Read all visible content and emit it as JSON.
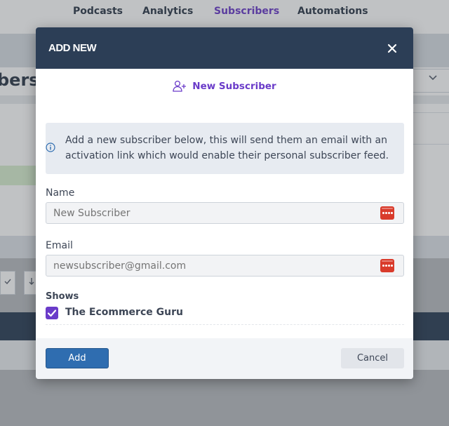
{
  "background": {
    "nav": {
      "items": [
        {
          "label": "Podcasts",
          "active": false
        },
        {
          "label": "Analytics",
          "active": false
        },
        {
          "label": "Subscribers",
          "active": true
        },
        {
          "label": "Automations",
          "active": false
        }
      ]
    },
    "page_title_fragment": "bers"
  },
  "modal": {
    "title": "ADD NEW",
    "close_icon": "close-icon",
    "subtitle_icon": "user-plus-icon",
    "subtitle": "New Subscriber",
    "info": {
      "icon": "info-circle-icon",
      "text": "Add a new subscriber below, this will send them an email with an activation link which would enable their personal subscriber feed."
    },
    "name": {
      "label": "Name",
      "placeholder": "New Subscriber",
      "value": ""
    },
    "email": {
      "label": "Email",
      "placeholder": "newsubscriber@gmail.com",
      "value": ""
    },
    "password_manager_icon": "password-manager-icon",
    "shows": {
      "label": "Shows",
      "items": [
        {
          "label": "The Ecommerce Guru",
          "checked": true
        }
      ]
    },
    "buttons": {
      "add": "Add",
      "cancel": "Cancel"
    }
  },
  "colors": {
    "header_bg": "#2c3e56",
    "accent_purple": "#6a3bc9",
    "primary_button": "#2f6db0",
    "password_icon": "#d93b2b"
  }
}
